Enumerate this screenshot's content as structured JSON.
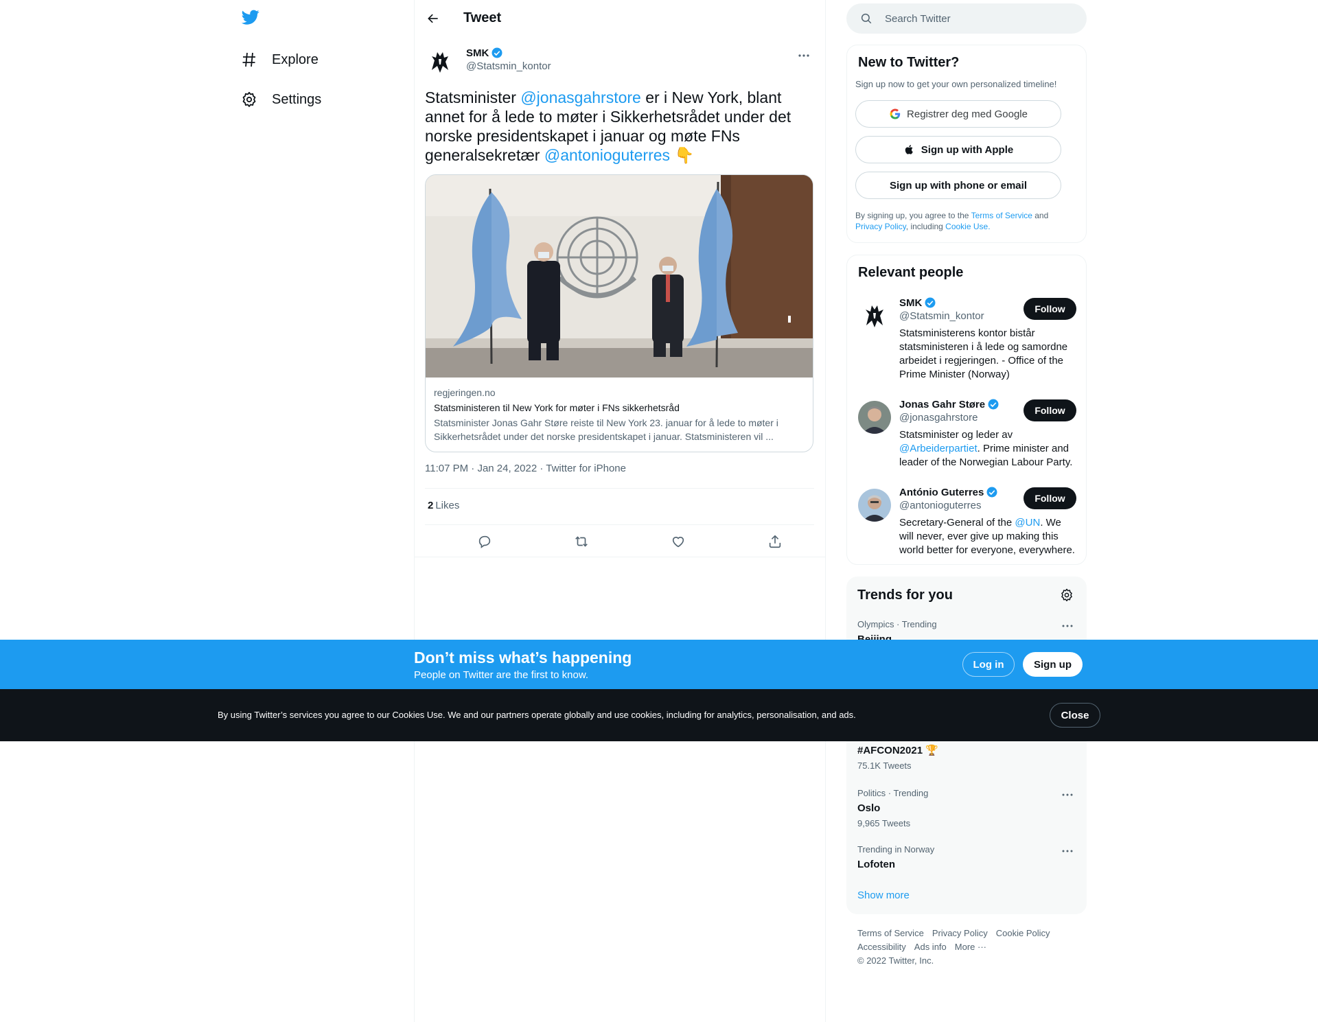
{
  "nav": {
    "logo_icon": "twitter-bird-icon",
    "items": [
      {
        "label": "Explore",
        "icon": "hashtag-icon"
      },
      {
        "label": "Settings",
        "icon": "gear-icon"
      }
    ]
  },
  "header": {
    "title": "Tweet"
  },
  "tweet": {
    "author_name": "SMK",
    "author_handle": "@Statsmin_kontor",
    "text_part1": "Statsminister ",
    "mention1": "@jonasgahrstore",
    "text_part2": " er i New York, blant annet for å lede to møter i Sikkerhetsrådet under det norske presidentskapet i januar og møte FNs generalsekretær ",
    "mention2": "@antonioguterres",
    "emoji": "👇",
    "card": {
      "domain": "regjeringen.no",
      "title": "Statsministeren til New York for møter i FNs sikkerhetsråd",
      "description": "Statsminister Jonas Gahr Støre reiste til New York 23. januar for å lede to møter i Sikkerhetsrådet under det norske presidentskapet i januar. Statsministeren vil ..."
    },
    "time": "11:07 PM",
    "date": "Jan 24, 2022",
    "source": "Twitter for iPhone",
    "likes_count": "2",
    "likes_label": "Likes"
  },
  "search": {
    "placeholder": "Search Twitter"
  },
  "new_to_twitter": {
    "title": "New to Twitter?",
    "subtitle": "Sign up now to get your own personalized timeline!",
    "google_label": "Registrer deg med Google",
    "apple_label": "Sign up with Apple",
    "phone_label": "Sign up with phone or email",
    "legal_prefix": "By signing up, you agree to the ",
    "terms": "Terms of Service",
    "and": " and",
    "privacy": "Privacy Policy",
    "including": ", including ",
    "cookie": "Cookie Use."
  },
  "relevant_people": {
    "title": "Relevant people",
    "follow_label": "Follow",
    "people": [
      {
        "name": "SMK",
        "handle": "@Statsmin_kontor",
        "bio": "Statsministerens kontor bistår statsministeren i å lede og samordne arbeidet i regjeringen. - Office of the Prime Minister (Norway)"
      },
      {
        "name": "Jonas Gahr Støre",
        "handle": "@jonasgahrstore",
        "bio_pre": "Statsminister og leder av ",
        "bio_link": "@Arbeiderpartiet",
        "bio_post": ". Prime minister and leader of the Norwegian Labour Party."
      },
      {
        "name": "António Guterres",
        "handle": "@antonioguterres",
        "bio_pre": "Secretary-General of the ",
        "bio_link": "@UN",
        "bio_post": ". We will never, ever give up making this world better for everyone, everywhere."
      }
    ]
  },
  "trends": {
    "title": "Trends for you",
    "items": [
      {
        "meta": "Olympics · Trending",
        "name": "Beijing",
        "count": ""
      },
      {
        "meta": "",
        "name": "#AFCON2021 🏆",
        "count": "75.1K Tweets"
      },
      {
        "meta": "Politics · Trending",
        "name": "Oslo",
        "count": "9,965 Tweets"
      },
      {
        "meta": "Trending in Norway",
        "name": "Lofoten",
        "count": ""
      }
    ],
    "show_more": "Show more"
  },
  "footer": {
    "links": [
      "Terms of Service",
      "Privacy Policy",
      "Cookie Policy",
      "Accessibility",
      "Ads info",
      "More ···"
    ],
    "copyright": "© 2022 Twitter, Inc."
  },
  "promo": {
    "title": "Don’t miss what’s happening",
    "subtitle": "People on Twitter are the first to know.",
    "login": "Log in",
    "signup": "Sign up"
  },
  "cookie_bar": {
    "text": "By using Twitter’s services you agree to our Cookies Use. We and our partners operate globally and use cookies, including for analytics, personalisation, and ads.",
    "close": "Close"
  },
  "colors": {
    "accent": "#1d9bf0",
    "text": "#0f1419",
    "muted": "#536471",
    "dark_bar": "#0f1419"
  }
}
